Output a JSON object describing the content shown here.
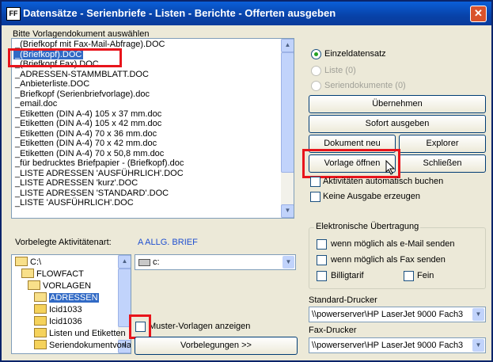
{
  "window": {
    "title": "Datensätze - Serienbriefe - Listen - Berichte - Offerten ausgeben",
    "app_icon": "FF",
    "close_glyph": "✕"
  },
  "templates": {
    "label": "Bitte Vorlagendokument auswählen",
    "items": [
      "_(Briefkopf mit Fax-Mail-Abfrage).DOC",
      "_(Briefkopf).DOC",
      "_(Briefkopf Fax).DOC",
      "_ADRESSEN-STAMMBLATT.DOC",
      "_Anbieterliste.DOC",
      "_Briefkopf (Serienbriefvorlage).doc",
      "_email.doc",
      "_Etiketten (DIN A-4) 105 x 37 mm.doc",
      "_Etiketten (DIN A-4) 105 x 42 mm.doc",
      "_Etiketten (DIN A-4) 70 x 36 mm.doc",
      "_Etiketten (DIN A-4) 70 x 42 mm.doc",
      "_Etiketten (DIN A-4) 70 x 50,8 mm.doc",
      "_für bedrucktes Briefpapier - (Briefkopf).doc",
      "_LISTE ADRESSEN 'AUSFÜHRLICH'.DOC",
      "_LISTE ADRESSEN 'kurz'.DOC",
      "_LISTE ADRESSEN 'STANDARD'.DOC",
      "_LISTE 'AUSFÜHRLICH'.DOC"
    ],
    "selected_index": 1
  },
  "activity": {
    "label": "Vorbelegte Aktivitätenart:",
    "value": "A ALLG. BRIEF",
    "value_color": "#1f4fd0"
  },
  "tree": {
    "items": [
      {
        "label": "C:\\",
        "indent": 0,
        "open": true
      },
      {
        "label": "FLOWFACT",
        "indent": 1,
        "open": true
      },
      {
        "label": "VORLAGEN",
        "indent": 2,
        "open": true
      },
      {
        "label": "ADRESSEN",
        "indent": 3,
        "open": true,
        "selected": true
      },
      {
        "label": "Icid1033",
        "indent": 3,
        "open": false
      },
      {
        "label": "Icid1036",
        "indent": 3,
        "open": false
      },
      {
        "label": "Listen und Etiketten",
        "indent": 3,
        "open": false
      },
      {
        "label": "Seriendokumentvorla",
        "indent": 3,
        "open": false
      }
    ]
  },
  "drive": {
    "value": "c:",
    "icon": "drive-icon"
  },
  "muster": {
    "label": "Muster-Vorlagen anzeigen",
    "checked": false
  },
  "vorbelegungen_button": "Vorbelegungen >>",
  "output_mode": {
    "options": [
      {
        "label": "Einzeldatensatz",
        "selected": true,
        "enabled": true
      },
      {
        "label": "Liste (0)",
        "selected": false,
        "enabled": false
      },
      {
        "label": "Seriendokumente (0)",
        "selected": false,
        "enabled": false
      }
    ]
  },
  "buttons": {
    "uebernehmen": "Übernehmen",
    "sofort": "Sofort ausgeben",
    "dokument_neu": "Dokument neu",
    "explorer": "Explorer",
    "vorlage_oeffnen": "Vorlage öffnen",
    "schliessen": "Schließen"
  },
  "options": {
    "aktivitaeten": "Aktivitäten automatisch buchen",
    "keine_ausgabe": "Keine Ausgabe erzeugen"
  },
  "electronic": {
    "title": "Elektronische Übertragung",
    "email": "wenn möglich als e-Mail senden",
    "fax": "wenn möglich als Fax senden",
    "billigtarif": "Billigtarif",
    "fein": "Fein"
  },
  "printers": {
    "standard_label": "Standard-Drucker",
    "standard_value": "\\\\powerserver\\HP LaserJet 9000 Fach3",
    "fax_label": "Fax-Drucker",
    "fax_value": "\\\\powerserver\\HP LaserJet 9000 Fach3"
  },
  "colors": {
    "highlight": "#e8141b",
    "selection": "#316ac5"
  }
}
